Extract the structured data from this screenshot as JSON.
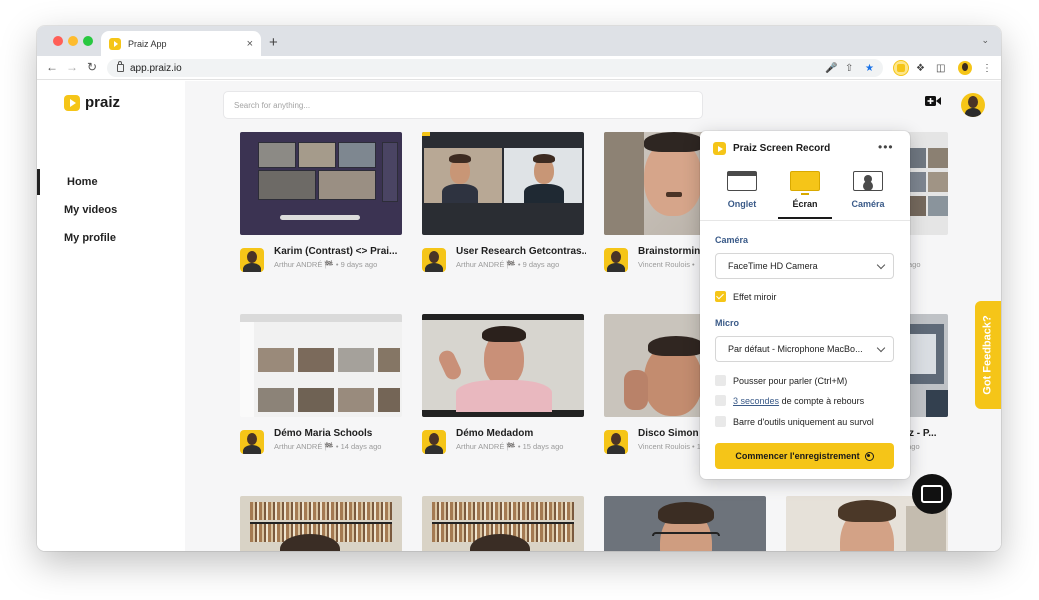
{
  "browser": {
    "tab_title": "Praiz App",
    "tab_close": "×",
    "new_tab": "+",
    "url": "app.praiz.io"
  },
  "sidebar": {
    "logo_text": "praiz",
    "items": [
      {
        "label": "Home",
        "active": true
      },
      {
        "label": "My videos",
        "active": false
      },
      {
        "label": "My profile",
        "active": false
      }
    ]
  },
  "header": {
    "search_placeholder": "Search for anything..."
  },
  "videos": [
    {
      "title": "Karim (Contrast) <> Prai...",
      "subtitle": "Arthur ANDRÉ 🏁 • 9 days ago"
    },
    {
      "title": "User Research Getcontras...",
      "subtitle": "Arthur ANDRÉ 🏁 • 9 days ago"
    },
    {
      "title": "Brainstorming",
      "subtitle": "Vincent Roulois •"
    },
    {
      "title": "",
      "subtitle": "ago"
    },
    {
      "title": "Démo Maria Schools",
      "subtitle": "Arthur ANDRÉ 🏁 • 14 days ago"
    },
    {
      "title": "Démo Medadom",
      "subtitle": "Arthur ANDRÉ 🏁 • 15 days ago"
    },
    {
      "title": "Disco Simon Robert (BigB...",
      "subtitle": "Vincent Roulois • 16 days ago"
    },
    {
      "title": "Discovery call Praiz - P...",
      "subtitle": "Vincent Roulois • 16 days ago"
    }
  ],
  "popup": {
    "title": "Praiz Screen Record",
    "more": "•••",
    "modes": [
      {
        "label": "Onglet",
        "selected": false
      },
      {
        "label": "Écran",
        "selected": true
      },
      {
        "label": "Caméra",
        "selected": false
      }
    ],
    "camera_label": "Caméra",
    "camera_value": "FaceTime HD Camera",
    "mirror_label": "Effet miroir",
    "mirror_checked": true,
    "micro_label": "Micro",
    "micro_value": "Par défaut - Microphone MacBo...",
    "push_to_talk": "Pousser pour parler (Ctrl+M)",
    "countdown_link": "3 secondes",
    "countdown_rest": "de compte à rebours",
    "toolbar_hover": "Barre d'outils uniquement au survol",
    "start_button": "Commencer l'enregistrement"
  },
  "feedback_label": "Got Feedback?",
  "colors": {
    "accent": "#f5c518",
    "label_blue": "#3a5a88"
  }
}
